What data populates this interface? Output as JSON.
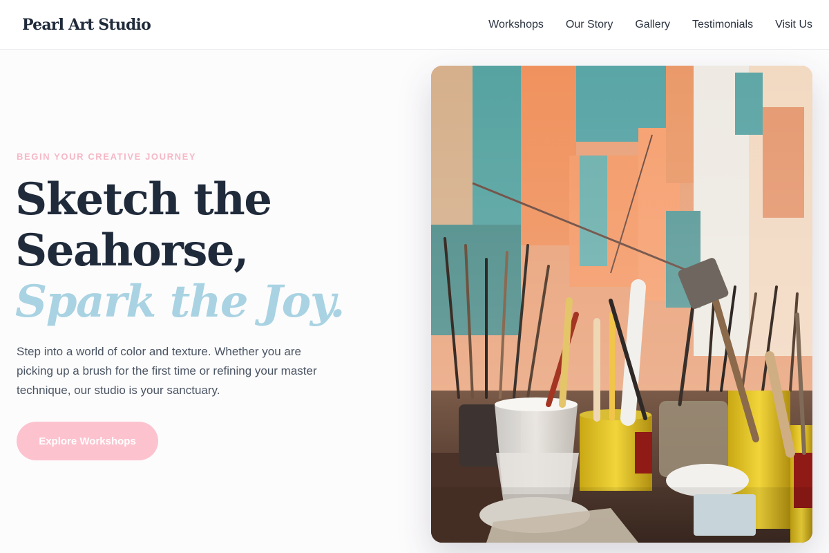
{
  "brand": {
    "name": "Pearl Art Studio"
  },
  "nav": {
    "items": [
      {
        "label": "Workshops"
      },
      {
        "label": "Our Story"
      },
      {
        "label": "Gallery"
      },
      {
        "label": "Testimonials"
      },
      {
        "label": "Visit Us"
      }
    ]
  },
  "hero": {
    "eyebrow": "BEGIN YOUR CREATIVE JOURNEY",
    "headline_line1": "Sketch the",
    "headline_line2": "Seahorse,",
    "headline_accent": "Spark the Joy.",
    "description": "Step into a world of color and texture. Whether you are picking up a brush for the first time or refining your master technique, our studio is your sanctuary.",
    "cta_label": "Explore Workshops",
    "image_subject": "art-studio-brushes-photo"
  },
  "colors": {
    "accent_pink": "#fcc3cf",
    "accent_blue": "#a9d3e2",
    "text_dark": "#1f2a3a",
    "eyebrow_pink": "#f5b8c6"
  }
}
